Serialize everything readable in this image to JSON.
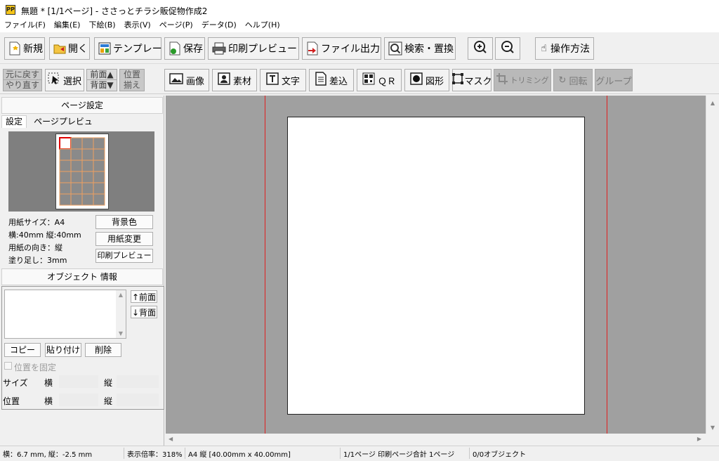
{
  "window": {
    "title": "無題 * [1/1ページ] - ささっとチラシ販促物作成2",
    "app_icon_text": "PP"
  },
  "menu": [
    "ファイル(F)",
    "編集(E)",
    "下絵(B)",
    "表示(V)",
    "ページ(P)",
    "データ(D)",
    "ヘルプ(H)"
  ],
  "toolbar1": {
    "new": "新規",
    "open": "開く",
    "template": "テンプレート",
    "save": "保存",
    "print_preview": "印刷プレビュー",
    "file_output": "ファイル出力",
    "search_replace": "検索・置換",
    "help": "操作方法"
  },
  "toolbar2": {
    "undo": "元に戻す",
    "redo": "やり直す",
    "select": "選択",
    "front": "前面▲",
    "back": "背面▼",
    "align_top": "位置",
    "align_bottom": "揃え",
    "image": "画像",
    "material": "素材",
    "text": "文字",
    "insert": "差込",
    "qr": "ＱＲ",
    "shape": "図形",
    "mask": "マスク",
    "trim": "トリミング",
    "rotate": "回転",
    "group": "グループ"
  },
  "page_settings": {
    "header": "ページ設定",
    "tab_settings": "設定",
    "tab_preview": "ページプレビュー",
    "paper_size": "用紙サイズ：A4",
    "dimensions": "横:40mm 縦:40mm",
    "orientation": "用紙の向き：縦",
    "bleed": "塗り足し：3mm",
    "bg_color_btn": "背景色",
    "change_paper_btn": "用紙変更",
    "print_preview_btn": "印刷プレビュー",
    "grid_cols": 4,
    "grid_rows": 6
  },
  "object_info": {
    "header": "オブジェクト 情報",
    "front_btn": "↑前面",
    "back_btn": "↓背面",
    "copy_btn": "コピー",
    "paste_btn": "貼り付け",
    "delete_btn": "削除",
    "lock_position": "位置を固定",
    "size_label": "サイズ",
    "position_label": "位置",
    "horizontal": "横",
    "vertical": "縦"
  },
  "status": {
    "coords": "横：6.7 mm, 縦：-2.5 mm",
    "zoom": "表示倍率：318%",
    "paper": "A4 縦 [40.00mm x 40.00mm]",
    "pages": "1/1ページ 印刷ページ合計 1ページ",
    "objects": "0/0オブジェクト"
  },
  "colors": {
    "canvas_bg": "#a0a0a0",
    "guide_line": "#e02020",
    "paper": "#ffffff"
  }
}
